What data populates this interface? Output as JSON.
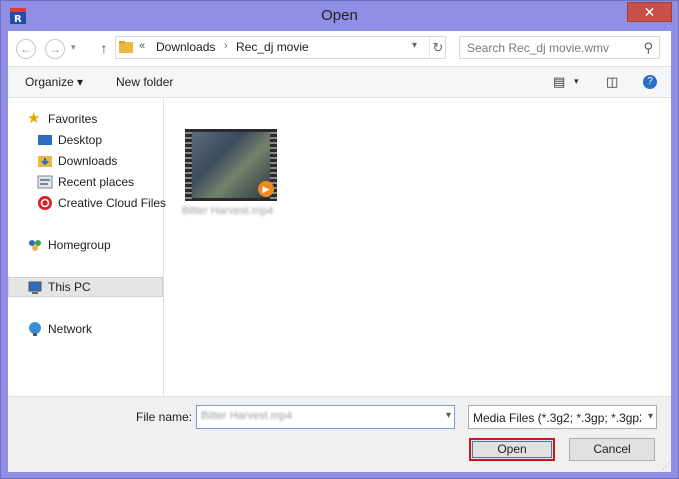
{
  "window": {
    "title": "Open",
    "close_label": "✕"
  },
  "nav": {
    "back_icon": "←",
    "forward_icon": "→",
    "up_icon": "↑",
    "breadcrumb_prefix": "«",
    "breadcrumbs": [
      "Downloads",
      "Rec_dj movie"
    ],
    "search_placeholder": "Search Rec_dj movie.wmv"
  },
  "toolbar": {
    "organize_label": "Organize ▾",
    "new_folder_label": "New folder"
  },
  "sidebar": {
    "favorites": "Favorites",
    "items": [
      "Desktop",
      "Downloads",
      "Recent places",
      "Creative Cloud Files"
    ],
    "homegroup": "Homegroup",
    "this_pc": "This PC",
    "network": "Network"
  },
  "files": [
    {
      "name": "Bitter Harvest.mp4"
    }
  ],
  "bottom": {
    "file_name_label": "File name:",
    "file_name_value": "Bitter Harvest.mp4",
    "file_type_value": "Media Files (*.3g2; *.3gp; *.3gp2",
    "open_label": "Open",
    "cancel_label": "Cancel"
  },
  "colors": {
    "titlebar": "#8f8fe6",
    "close": "#c7504a",
    "highlight": "#d1141c"
  }
}
